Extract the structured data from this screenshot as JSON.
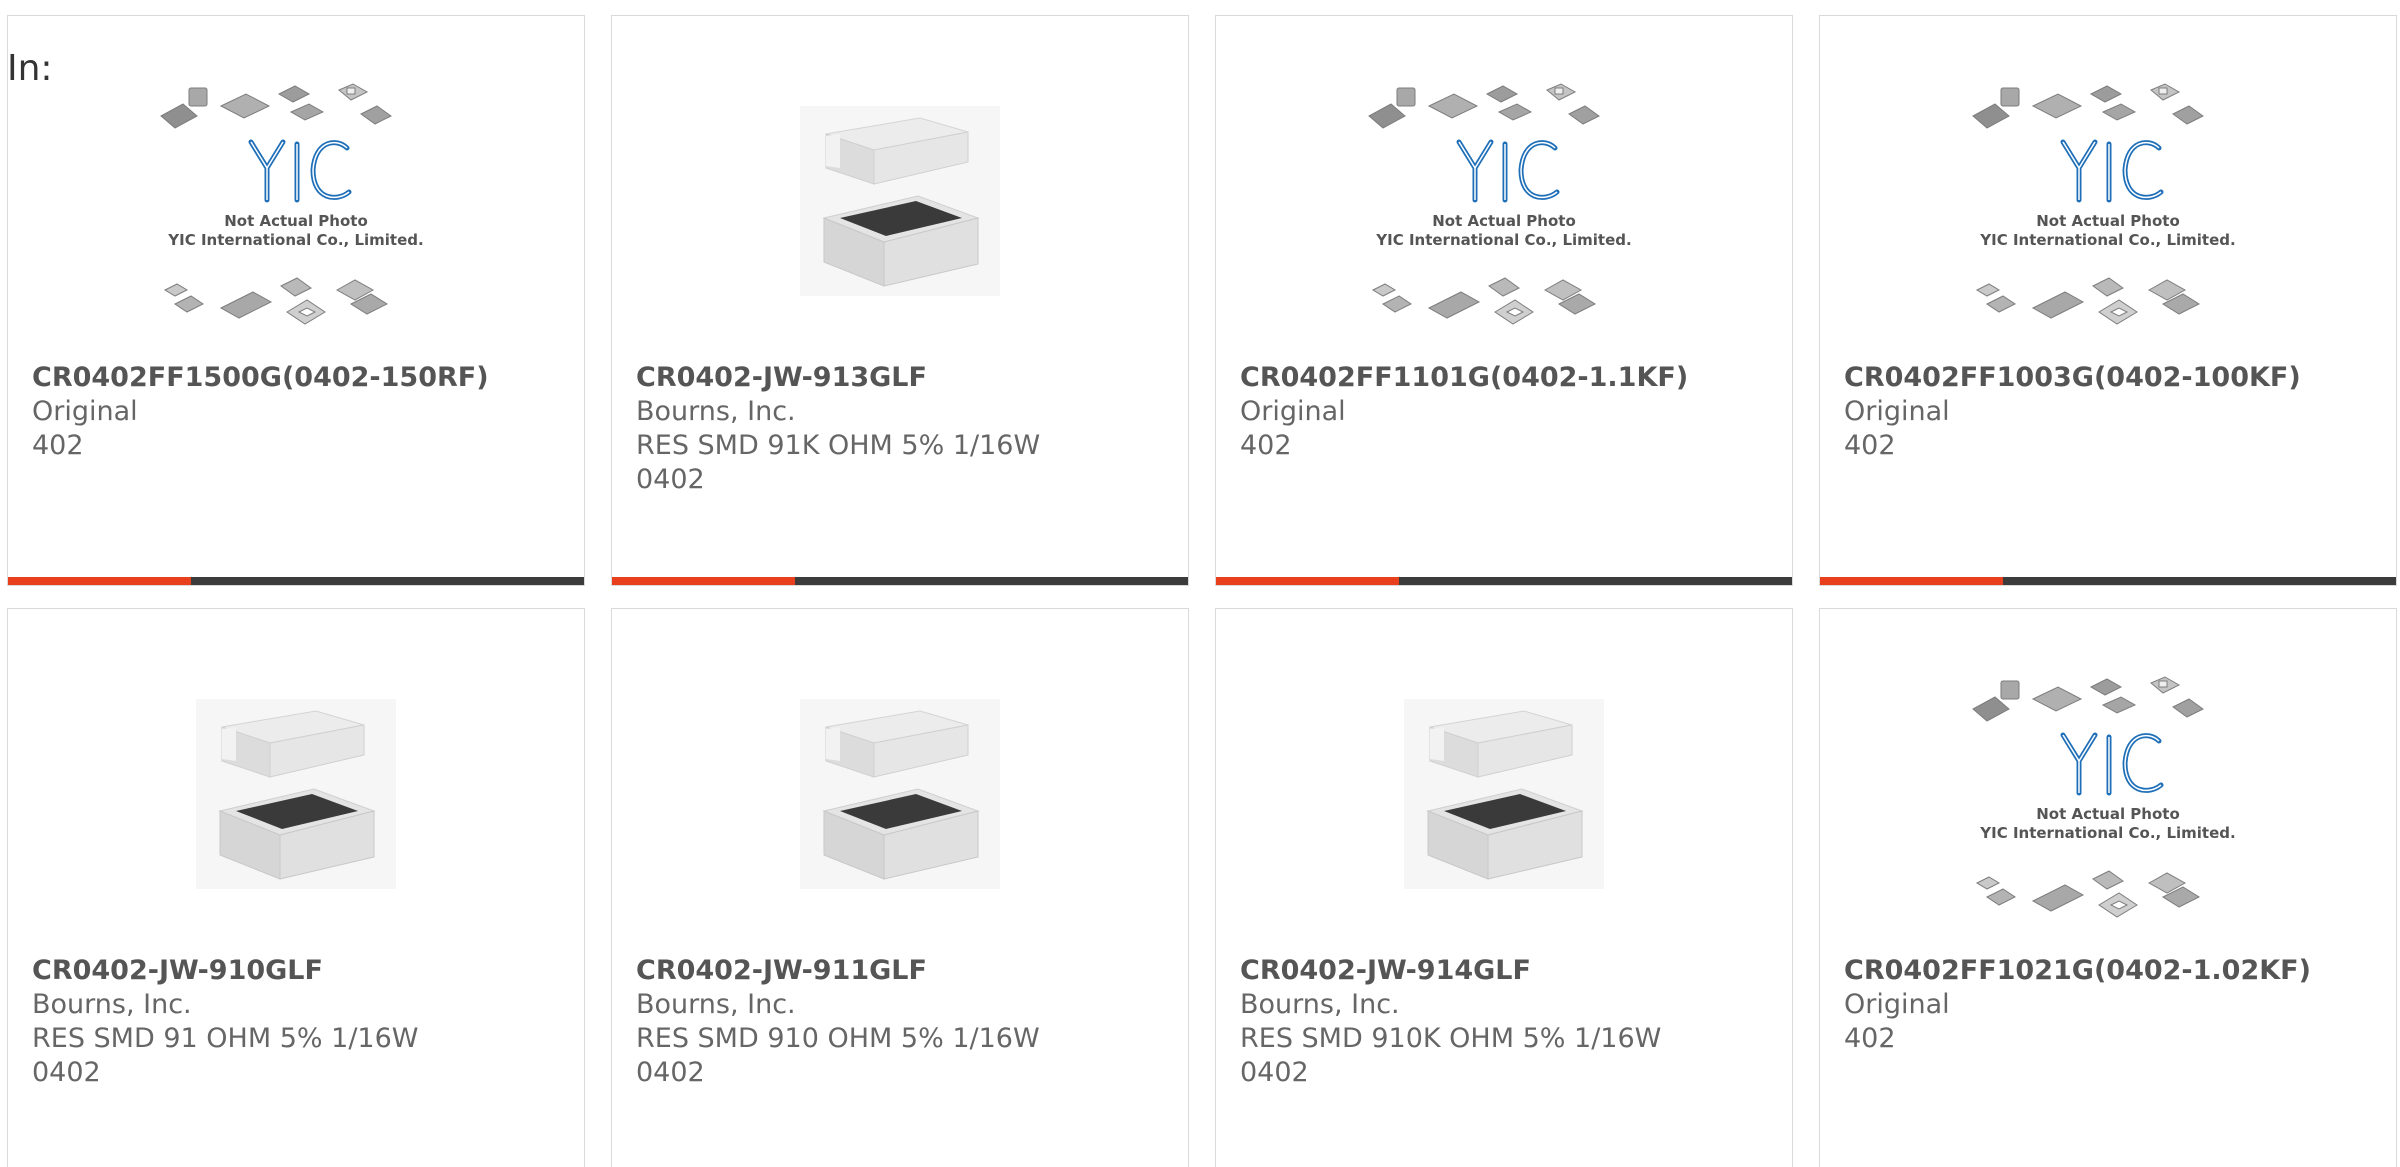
{
  "header": {
    "in_label": "In:"
  },
  "placeholder_text": {
    "logo": "YIC",
    "line1": "Not Actual Photo",
    "line2": "YIC International Co., Limited."
  },
  "colors": {
    "accent": "#e8401c",
    "bar": "#3b3b3b",
    "logo_blue": "#1e6fb8"
  },
  "products": [
    {
      "part": "CR0402FF1500G(0402-150RF)",
      "line1": "Original",
      "line2": "402",
      "line3": "",
      "image": "placeholder"
    },
    {
      "part": "CR0402-JW-913GLF",
      "line1": "Bourns, Inc.",
      "line2": "RES SMD 91K OHM 5% 1/16W",
      "line3": "0402",
      "image": "resistor"
    },
    {
      "part": "CR0402FF1101G(0402-1.1KF)",
      "line1": "Original",
      "line2": "402",
      "line3": "",
      "image": "placeholder"
    },
    {
      "part": "CR0402FF1003G(0402-100KF)",
      "line1": "Original",
      "line2": "402",
      "line3": "",
      "image": "placeholder"
    },
    {
      "part": "CR0402-JW-910GLF",
      "line1": "Bourns, Inc.",
      "line2": "RES SMD 91 OHM 5% 1/16W",
      "line3": "0402",
      "image": "resistor"
    },
    {
      "part": "CR0402-JW-911GLF",
      "line1": "Bourns, Inc.",
      "line2": "RES SMD 910 OHM 5% 1/16W",
      "line3": "0402",
      "image": "resistor"
    },
    {
      "part": "CR0402-JW-914GLF",
      "line1": "Bourns, Inc.",
      "line2": "RES SMD 910K OHM 5% 1/16W",
      "line3": "0402",
      "image": "resistor"
    },
    {
      "part": "CR0402FF1021G(0402-1.02KF)",
      "line1": "Original",
      "line2": "402",
      "line3": "",
      "image": "placeholder"
    }
  ]
}
